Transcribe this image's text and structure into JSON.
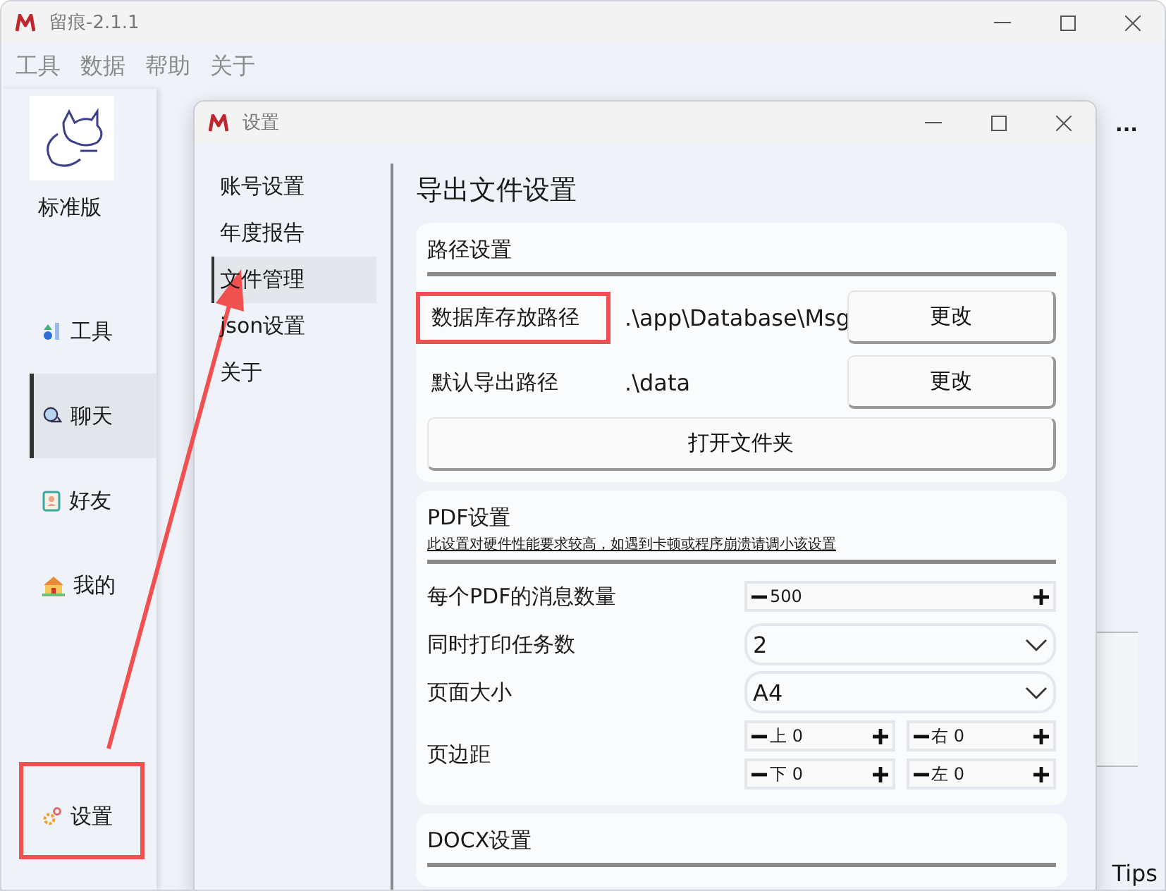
{
  "main_window": {
    "title": "留痕-2.1.1",
    "menu": [
      "工具",
      "数据",
      "帮助",
      "关于"
    ],
    "edition": "标准版",
    "nav": [
      {
        "label": "工具",
        "kind": "tools",
        "selected": false
      },
      {
        "label": "聊天",
        "kind": "chat",
        "selected": true
      },
      {
        "label": "好友",
        "kind": "friends",
        "selected": false
      },
      {
        "label": "我的",
        "kind": "me",
        "selected": false
      },
      {
        "label": "设置",
        "kind": "settings",
        "selected": false
      }
    ],
    "more": "...",
    "tips": "Tips"
  },
  "dialog": {
    "title": "设置",
    "nav": [
      {
        "label": "账号设置",
        "selected": false
      },
      {
        "label": "年度报告",
        "selected": false
      },
      {
        "label": "文件管理",
        "selected": true
      },
      {
        "label": "json设置",
        "selected": false
      },
      {
        "label": "关于",
        "selected": false
      }
    ],
    "heading": "导出文件设置",
    "path_section": {
      "title": "路径设置",
      "rows": [
        {
          "label": "数据库存放路径",
          "value": ".\\app\\Database\\Msg",
          "button": "更改",
          "highlighted": true
        },
        {
          "label": "默认导出路径",
          "value": ".\\data",
          "button": "更改",
          "highlighted": false
        }
      ],
      "open_button": "打开文件夹"
    },
    "pdf_section": {
      "title": "PDF设置",
      "note": "此设置对硬件性能要求较高，如遇到卡顿或程序崩溃请调小该设置",
      "rows": [
        {
          "kind": "spin",
          "label": "每个PDF的消息数量",
          "values": [
            "500"
          ]
        },
        {
          "kind": "select",
          "label": "同时打印任务数",
          "values": [
            "2"
          ]
        },
        {
          "kind": "select",
          "label": "页面大小",
          "values": [
            "A4"
          ]
        },
        {
          "kind": "margins",
          "label": "页边距",
          "values": [
            "上 0",
            "右 0",
            "下 0",
            "左 0"
          ]
        }
      ]
    },
    "docx_section": {
      "title": "DOCX设置"
    }
  }
}
